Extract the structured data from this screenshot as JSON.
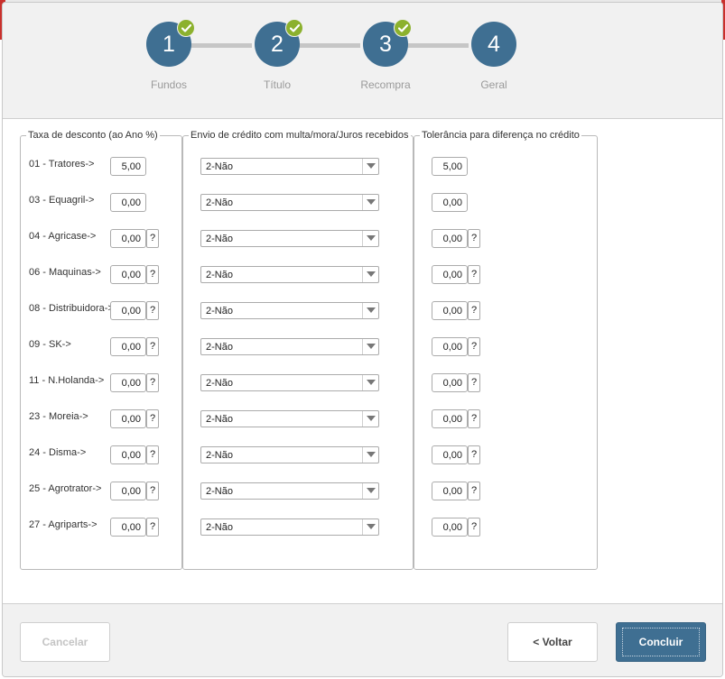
{
  "wizard": {
    "steps": [
      {
        "number": "1",
        "label": "Fundos",
        "completed": true
      },
      {
        "number": "2",
        "label": "Título",
        "completed": true
      },
      {
        "number": "3",
        "label": "Recompra",
        "completed": true
      },
      {
        "number": "4",
        "label": "Geral",
        "completed": false
      }
    ]
  },
  "sections": {
    "discount": {
      "legend": "Taxa de desconto (ao Ano %)"
    },
    "credit": {
      "legend": "Envio de crédito com multa/mora/Juros recebidos"
    },
    "tolerance": {
      "legend": "Tolerância para diferença no crédito"
    }
  },
  "help_label": "?",
  "rows": [
    {
      "label": "01 - Tratores->",
      "discount": "5,00",
      "credit": "2-Não",
      "tolerance": "5,00",
      "help": false
    },
    {
      "label": "03 - Equagril->",
      "discount": "0,00",
      "credit": "2-Não",
      "tolerance": "0,00",
      "help": false
    },
    {
      "label": "04 - Agricase->",
      "discount": "0,00",
      "credit": "2-Não",
      "tolerance": "0,00",
      "help": true
    },
    {
      "label": "06 - Maquinas->",
      "discount": "0,00",
      "credit": "2-Não",
      "tolerance": "0,00",
      "help": true
    },
    {
      "label": "08 - Distribuidora->",
      "discount": "0,00",
      "credit": "2-Não",
      "tolerance": "0,00",
      "help": true
    },
    {
      "label": "09 - SK->",
      "discount": "0,00",
      "credit": "2-Não",
      "tolerance": "0,00",
      "help": true
    },
    {
      "label": "11 - N.Holanda->",
      "discount": "0,00",
      "credit": "2-Não",
      "tolerance": "0,00",
      "help": true
    },
    {
      "label": "23 - Moreia->",
      "discount": "0,00",
      "credit": "2-Não",
      "tolerance": "0,00",
      "help": true
    },
    {
      "label": "24 - Disma->",
      "discount": "0,00",
      "credit": "2-Não",
      "tolerance": "0,00",
      "help": true
    },
    {
      "label": "25 - Agrotrator->",
      "discount": "0,00",
      "credit": "2-Não",
      "tolerance": "0,00",
      "help": true
    },
    {
      "label": "27 - Agriparts->",
      "discount": "0,00",
      "credit": "2-Não",
      "tolerance": "0,00",
      "help": true
    }
  ],
  "footer": {
    "cancel_label": "Cancelar",
    "back_label": "< Voltar",
    "finish_label": "Concluir"
  },
  "colors": {
    "step_circle": "#3f6f92",
    "check_badge": "#8cb12e",
    "primary_button": "#3f6f92"
  },
  "icons": {
    "step_check": "check-icon",
    "select_arrow": "caret-down-icon"
  }
}
